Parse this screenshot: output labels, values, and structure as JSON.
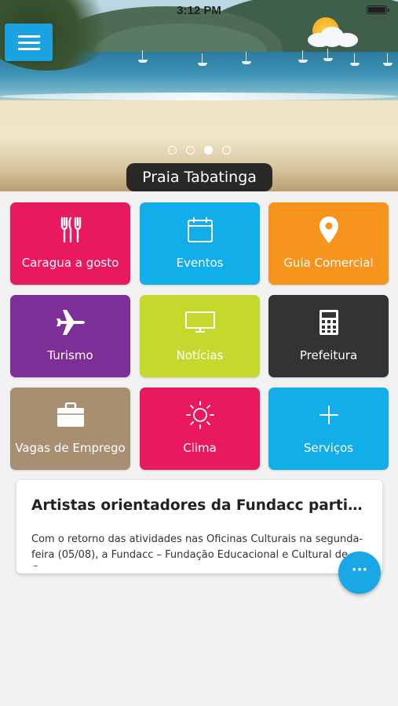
{
  "status_bar": {
    "time": "3:12 PM"
  },
  "header": {
    "menu_icon": "hamburger-menu-icon",
    "weather_icon": "partly-cloudy-icon"
  },
  "banner": {
    "caption": "Praia Tabatinga",
    "pagination": {
      "count": 4,
      "active_index": 2
    }
  },
  "tiles": [
    {
      "label": "Caragua a gosto",
      "icon": "fork-knife-icon",
      "color": "#e8195d"
    },
    {
      "label": "Eventos",
      "icon": "calendar-icon",
      "color": "#12aee9"
    },
    {
      "label": "Guia Comercial",
      "icon": "map-pin-icon",
      "color": "#f7941d"
    },
    {
      "label": "Turismo",
      "icon": "airplane-icon",
      "color": "#7d2e97"
    },
    {
      "label": "Notícias",
      "icon": "tv-icon",
      "color": "#c4d82d"
    },
    {
      "label": "Prefeitura",
      "icon": "calculator-icon",
      "color": "#333333"
    },
    {
      "label": "Vagas de Emprego",
      "icon": "briefcase-icon",
      "color": "#a88f72"
    },
    {
      "label": "Clima",
      "icon": "sun-icon",
      "color": "#e8195d"
    },
    {
      "label": "Serviços",
      "icon": "plus-icon",
      "color": "#12aee9"
    }
  ],
  "news": {
    "title": "Artistas orientadores da Fundacc particip...",
    "excerpt": "Com o retorno das atividades nas Oficinas Culturais na segunda-feira (05/08), a Fundacc – Fundação Educacional e Cultural de Ca..."
  },
  "fab": {
    "label": "···",
    "icon": "more-dots-icon"
  }
}
